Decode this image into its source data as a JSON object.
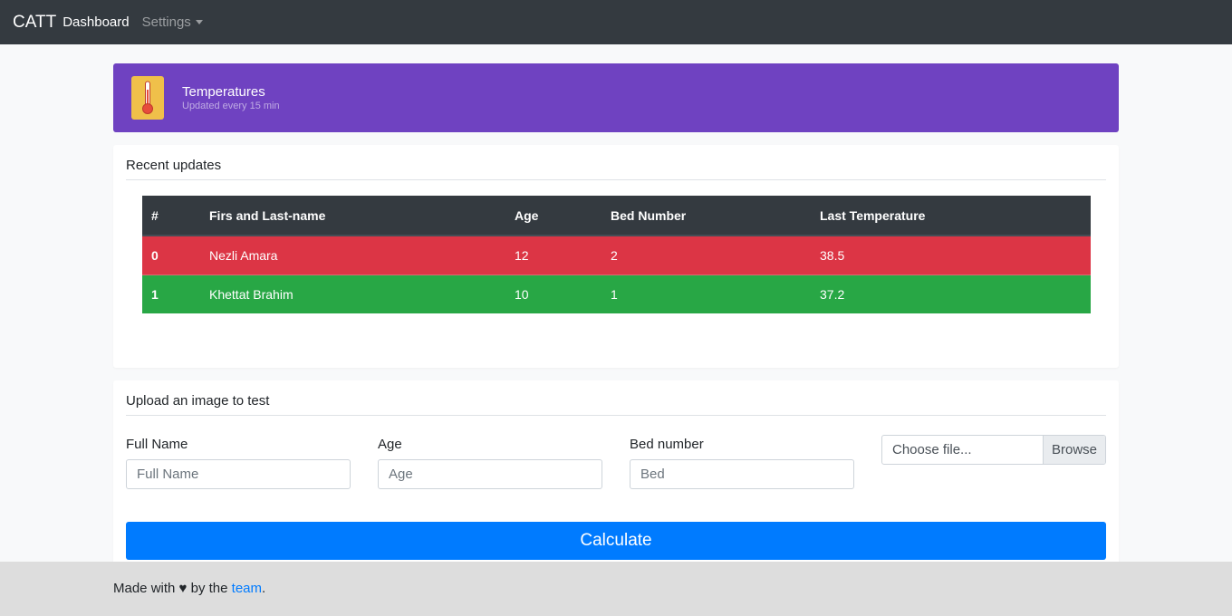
{
  "navbar": {
    "brand": "CATT",
    "dashboard_label": "Dashboard",
    "settings_label": "Settings"
  },
  "banner": {
    "title": "Temperatures",
    "subtitle": "Updated every 15 min",
    "icon": "thermometer-icon",
    "color": "#6f42c1"
  },
  "updates": {
    "heading": "Recent updates",
    "columns": [
      "#",
      "Firs and Last-name",
      "Age",
      "Bed Number",
      "Last Temperature"
    ],
    "rows": [
      {
        "index": "0",
        "name": "Nezli Amara",
        "age": "12",
        "bed": "2",
        "temperature": "38.5",
        "status_color": "#dc3545"
      },
      {
        "index": "1",
        "name": "Khettat Brahim",
        "age": "10",
        "bed": "1",
        "temperature": "37.2",
        "status_color": "#28a745"
      }
    ]
  },
  "upload": {
    "heading": "Upload an image to test",
    "full_name": {
      "label": "Full Name",
      "placeholder": "Full Name",
      "value": ""
    },
    "age": {
      "label": "Age",
      "placeholder": "Age",
      "value": ""
    },
    "bed": {
      "label": "Bed number",
      "placeholder": "Bed",
      "value": ""
    },
    "file": {
      "placeholder": "Choose file...",
      "button": "Browse"
    },
    "submit_label": "Calculate"
  },
  "footer": {
    "prefix": "Made with",
    "heart": "♥",
    "by": "by the",
    "link": "team",
    "suffix": "."
  }
}
